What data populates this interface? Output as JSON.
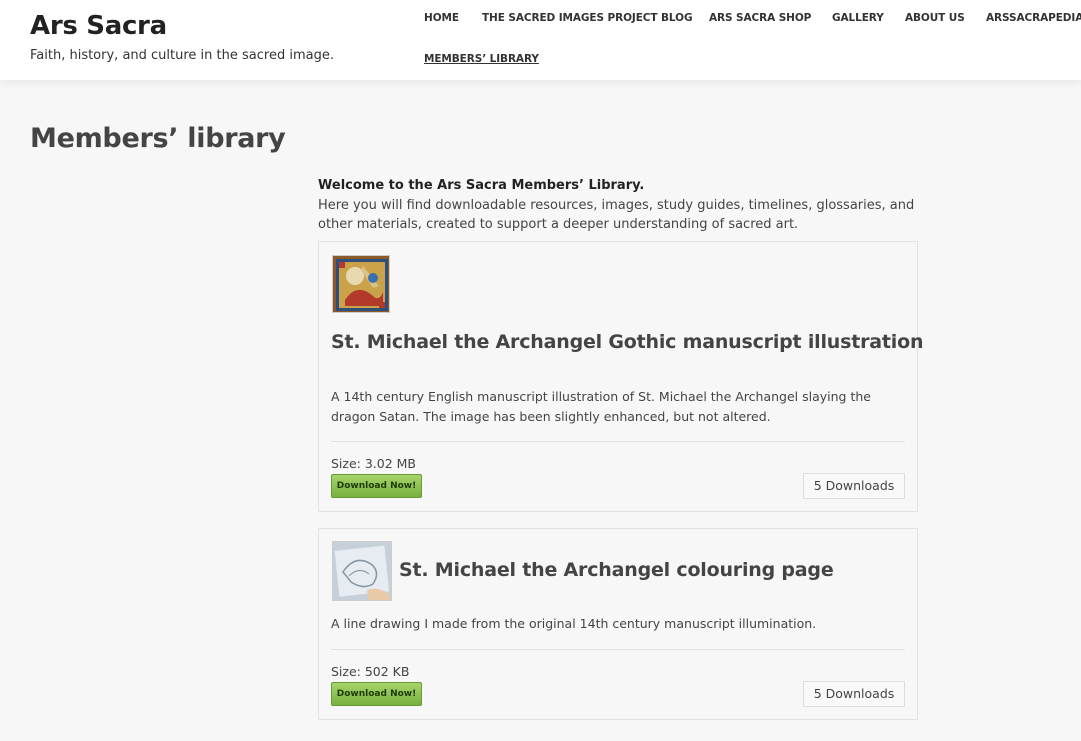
{
  "site": {
    "title": "Ars Sacra",
    "tagline": "Faith, history, and culture in the sacred image."
  },
  "nav": {
    "items": [
      {
        "label": "HOME"
      },
      {
        "label": "THE SACRED IMAGES PROJECT BLOG"
      },
      {
        "label": "ARS SACRA SHOP"
      },
      {
        "label": "GALLERY"
      },
      {
        "label": "ABOUT US"
      },
      {
        "label": "ARSSACRAPEDIA"
      },
      {
        "label": "MEMBERS’ LIBRARY"
      }
    ]
  },
  "page": {
    "title": "Members’ library",
    "intro_heading": "Welcome to the Ars Sacra Members’ Library.",
    "intro_text": "Here you will find downloadable resources, images, study guides, timelines, glossaries, and other materials, created to support a deeper understanding of sacred art."
  },
  "downloads": [
    {
      "title": "St. Michael the Archangel Gothic manuscript illustration",
      "description": "A 14th century English manuscript illustration of St. Michael the Archangel slaying the dragon Satan. The image has been slightly enhanced, but not altered.",
      "size": "Size: 3.02 MB",
      "button": "Download Now!",
      "count": "5 Downloads"
    },
    {
      "title": "St. Michael the Archangel colouring page",
      "description": "A line drawing I made from the original 14th century manuscript illumination.",
      "size": "Size: 502 KB",
      "button": "Download Now!",
      "count": "5 Downloads"
    }
  ]
}
